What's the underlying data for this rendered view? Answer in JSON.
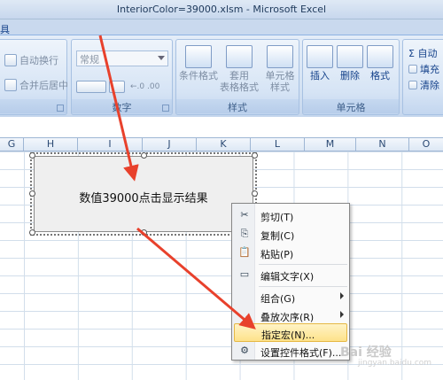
{
  "window": {
    "title": "InteriorColor=39000.xlsm - Microsoft Excel"
  },
  "tab_fragment": "具",
  "ribbon": {
    "alignment": {
      "wrap_label": "自动换行",
      "merge_label": "合并后居中",
      "merge_arrow": "▾"
    },
    "number": {
      "format_value": "常规",
      "group_label": "数字",
      "dec_inc": "←.0 .00",
      "dec_dec": ".00 →.0"
    },
    "styles": {
      "conditional_label": "条件格式",
      "table_label_1": "套用",
      "table_label_2": "表格格式",
      "cell_style_label_1": "单元格",
      "cell_style_label_2": "样式",
      "group_label": "样式"
    },
    "cells": {
      "insert_label": "插入",
      "delete_label": "删除",
      "format_label": "格式",
      "group_label": "单元格"
    },
    "editing": {
      "sum_label": "Σ 自动",
      "fill_label": "填充",
      "clear_label": "清除"
    }
  },
  "columns": [
    "G",
    "H",
    "I",
    "J",
    "K",
    "L",
    "M",
    "N",
    "O"
  ],
  "form_button": {
    "caption": "数值39000点击显示结果"
  },
  "context_menu": {
    "items": [
      {
        "label": "剪切(T)",
        "icon": "scissors-icon",
        "glyph": "✂"
      },
      {
        "label": "复制(C)",
        "icon": "copy-icon",
        "glyph": "⎘"
      },
      {
        "label": "粘贴(P)",
        "icon": "paste-icon",
        "glyph": "📋"
      },
      {
        "label": "编辑文字(X)",
        "icon": "edit-text-icon",
        "glyph": "▭"
      },
      {
        "label": "组合(G)",
        "icon": "",
        "glyph": ""
      },
      {
        "label": "叠放次序(R)",
        "icon": "",
        "glyph": ""
      },
      {
        "label": "指定宏(N)...",
        "icon": "",
        "glyph": ""
      },
      {
        "label": "设置控件格式(F)...",
        "icon": "format-control-icon",
        "glyph": "⚙"
      }
    ],
    "highlighted_index": 6
  },
  "watermark": {
    "text": "Bai 经验",
    "sub": "jingyan.baidu.com"
  },
  "colors": {
    "arrow": "#e8412c",
    "highlight": "#fde28a"
  }
}
